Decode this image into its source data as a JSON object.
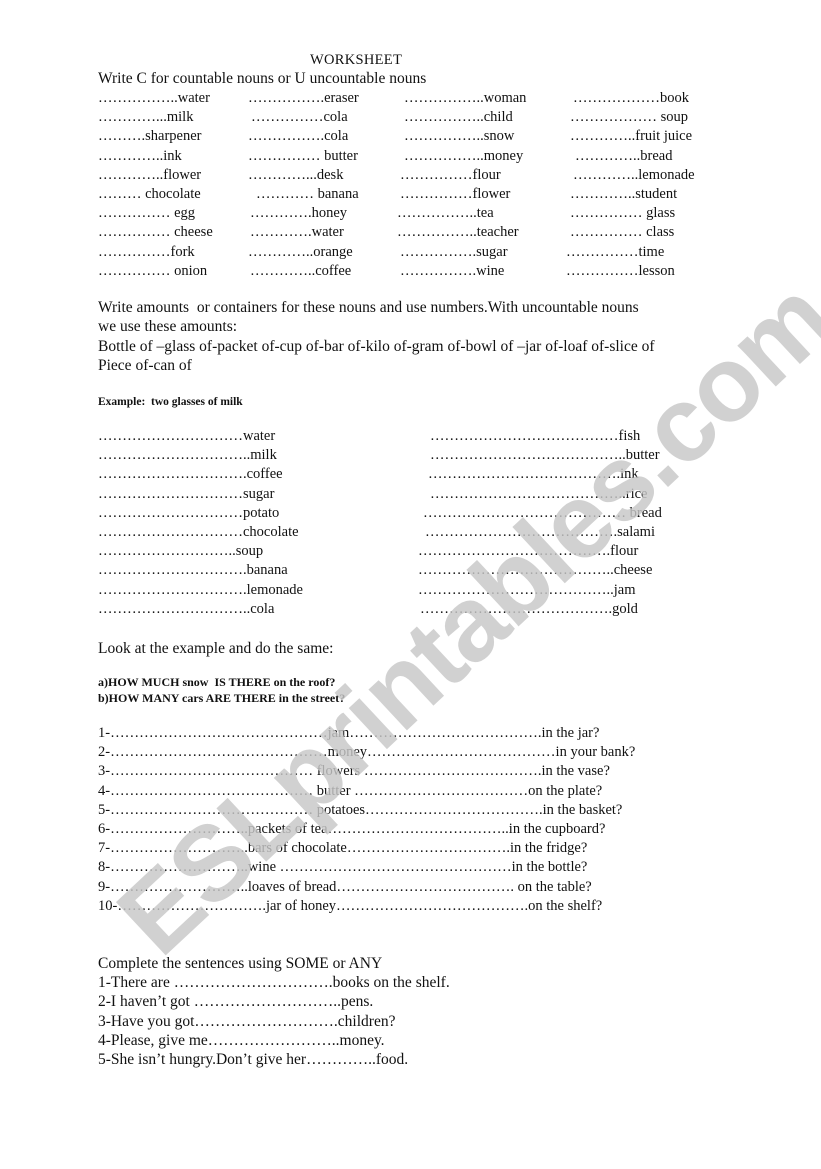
{
  "title": "WORKSHEET",
  "section1": {
    "instruction": "Write C for countable nouns or U uncountable nouns",
    "rows": [
      [
        "……………..water",
        "…………….eraser",
        "……………..woman",
        "………………book"
      ],
      [
        "…………...milk",
        "……………cola",
        "……………..child",
        "……………… soup"
      ],
      [
        "……….sharpener",
        "…………….cola",
        "……………..snow",
        "…………..fruit juice"
      ],
      [
        "…………..ink",
        "…………… butter",
        "……………..money",
        "…………..bread"
      ],
      [
        "…………..flower",
        "…………...desk",
        "……………flour",
        "…………..lemonade"
      ],
      [
        "……… chocolate",
        "………… banana",
        "……………flower",
        "…………..student"
      ],
      [
        "…………… egg",
        "………….honey",
        "……………..tea",
        "…………… glass"
      ],
      [
        "…………… cheese",
        "………….water",
        "……………..teacher",
        "…………… class"
      ],
      [
        "……………fork",
        "…………..orange",
        "…………….sugar",
        "……………time"
      ],
      [
        "…………… onion",
        "…………..coffee",
        "…………….wine",
        "……………lesson"
      ]
    ]
  },
  "section2": {
    "instruction_line1": "Write amounts  or containers for these nouns and use numbers.With uncountable nouns",
    "instruction_line2": "we use these amounts:",
    "amounts_line1": "Bottle of –glass of-packet of-cup of-bar of-kilo of-gram of-bowl of –jar of-loaf of-slice of",
    "amounts_line2": "Piece of-can of",
    "example": "Example:  two glasses of milk",
    "left_items": [
      "…………………………water",
      "…………………………..milk",
      "………………………….coffee",
      "…………………………sugar",
      "…………………………potato",
      "…………………………chocolate",
      "………………………..soup",
      "………………………….banana",
      "………………………….lemonade",
      "…………………………..cola"
    ],
    "right_items": [
      "…………………………………fish",
      "…………………………………..butter",
      "………………………………….ink",
      "…………………………………..rice",
      "…………………………………… bread",
      "………………………………….salami",
      "………………………………….flour",
      "…………………………………..cheese",
      "…………………………………..jam",
      "………………………………….gold"
    ]
  },
  "section3": {
    "instruction": "Look at the example and do the same:",
    "example_a": "a)HOW MUCH snow  IS THERE on the roof?",
    "example_b": "b)HOW MANY cars ARE THERE in the street?",
    "questions": [
      "1-………………………………………jam………………………………….in the jar?",
      "2-………………………………………money…………………………………in your bank?",
      "3-…………………………………… flowers ……………………………….in the vase?",
      "4-…………………………………… butter ………………………………on the plate?",
      "5-…………………………………… potatoes……………………………….in the basket?",
      "6-………………………..packets of tea………………………………..in the cupboard?",
      "7-………………………..bars of chocolate…………………………….in the fridge?",
      "8-………………………..wine …………………………………………in the bottle?",
      "9-………………………..loaves of bread………………………………. on the table?",
      "10-………………………….jar of honey………………………………….on the shelf?"
    ]
  },
  "section4": {
    "instruction": "Complete the sentences using SOME or ANY",
    "sentences": [
      "1-There are ………………………….books on the shelf.",
      "2-I haven’t got ………………………..pens.",
      "3-Have you got……………………….children?",
      "4-Please, give me……………………..money.",
      "5-She isn’t hungry.Don’t give her…………..food."
    ]
  },
  "watermark": "ESLprintables.com"
}
